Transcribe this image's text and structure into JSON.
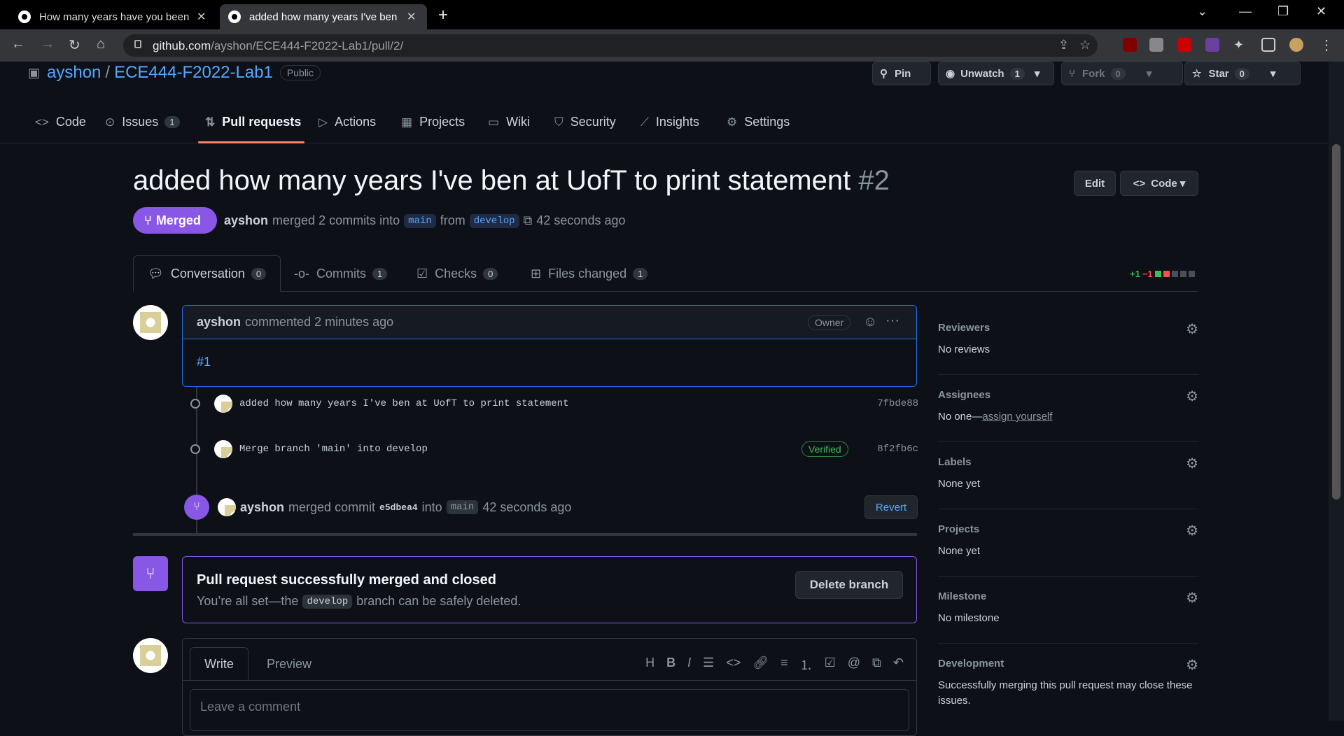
{
  "browser": {
    "tabs": [
      {
        "title": "How many years have you been at",
        "active": false
      },
      {
        "title": "added how many years I've ben at",
        "active": true
      }
    ],
    "url_host": "github.com",
    "url_path": "/ayshon/ECE444-F2022-Lab1/pull/2/"
  },
  "repo": {
    "owner": "ayshon",
    "name": "ECE444-F2022-Lab1",
    "visibility": "Public",
    "pin_label": "Pin",
    "unwatch_label": "Unwatch",
    "watch_count": "1",
    "fork_label": "Fork",
    "fork_count": "0",
    "star_label": "Star",
    "star_count": "0"
  },
  "nav": {
    "code": "Code",
    "issues": "Issues",
    "issues_count": "1",
    "pulls": "Pull requests",
    "actions": "Actions",
    "projects": "Projects",
    "wiki": "Wiki",
    "security": "Security",
    "insights": "Insights",
    "settings": "Settings"
  },
  "pr": {
    "title": "added how many years I've ben at UofT to print statement",
    "number": "#2",
    "status": "Merged",
    "author": "ayshon",
    "meta_text": "merged 2 commits into",
    "base": "main",
    "from_text": "from",
    "head": "develop",
    "time": "42 seconds ago",
    "edit_label": "Edit",
    "code_label": "Code"
  },
  "tabs": {
    "conversation": "Conversation",
    "conversation_count": "0",
    "commits": "Commits",
    "commits_count": "1",
    "checks": "Checks",
    "checks_count": "0",
    "files": "Files changed",
    "files_count": "1",
    "additions": "+1",
    "deletions": "−1"
  },
  "comment": {
    "author": "ayshon",
    "action": "commented 2 minutes ago",
    "role": "Owner",
    "body": "#1"
  },
  "commits": [
    {
      "message": "added how many years I've ben at UofT to print statement",
      "sha": "7fbde88",
      "verified": ""
    },
    {
      "message": "Merge branch 'main' into develop",
      "sha": "8f2fb6c",
      "verified": "Verified"
    }
  ],
  "merge_event": {
    "author": "ayshon",
    "text1": "merged commit",
    "sha": "e5dbea4",
    "text2": "into",
    "branch": "main",
    "time": "42 seconds ago",
    "revert_label": "Revert"
  },
  "merged_box": {
    "title": "Pull request successfully merged and closed",
    "sub1": "You’re all set—the",
    "branch": "develop",
    "sub2": "branch can be safely deleted.",
    "delete_label": "Delete branch"
  },
  "editor": {
    "write_tab": "Write",
    "preview_tab": "Preview",
    "placeholder": "Leave a comment"
  },
  "sidebar": {
    "reviewers_title": "Reviewers",
    "reviewers_val": "No reviews",
    "assignees_title": "Assignees",
    "assignees_val": "No one—",
    "assign_link": "assign yourself",
    "labels_title": "Labels",
    "labels_val": "None yet",
    "projects_title": "Projects",
    "projects_val": "None yet",
    "milestone_title": "Milestone",
    "milestone_val": "No milestone",
    "development_title": "Development",
    "development_val": "Successfully merging this pull request may close these issues."
  },
  "colors": {
    "merged": "#8957e5",
    "link": "#58a6ff",
    "bg": "#0d1117"
  }
}
